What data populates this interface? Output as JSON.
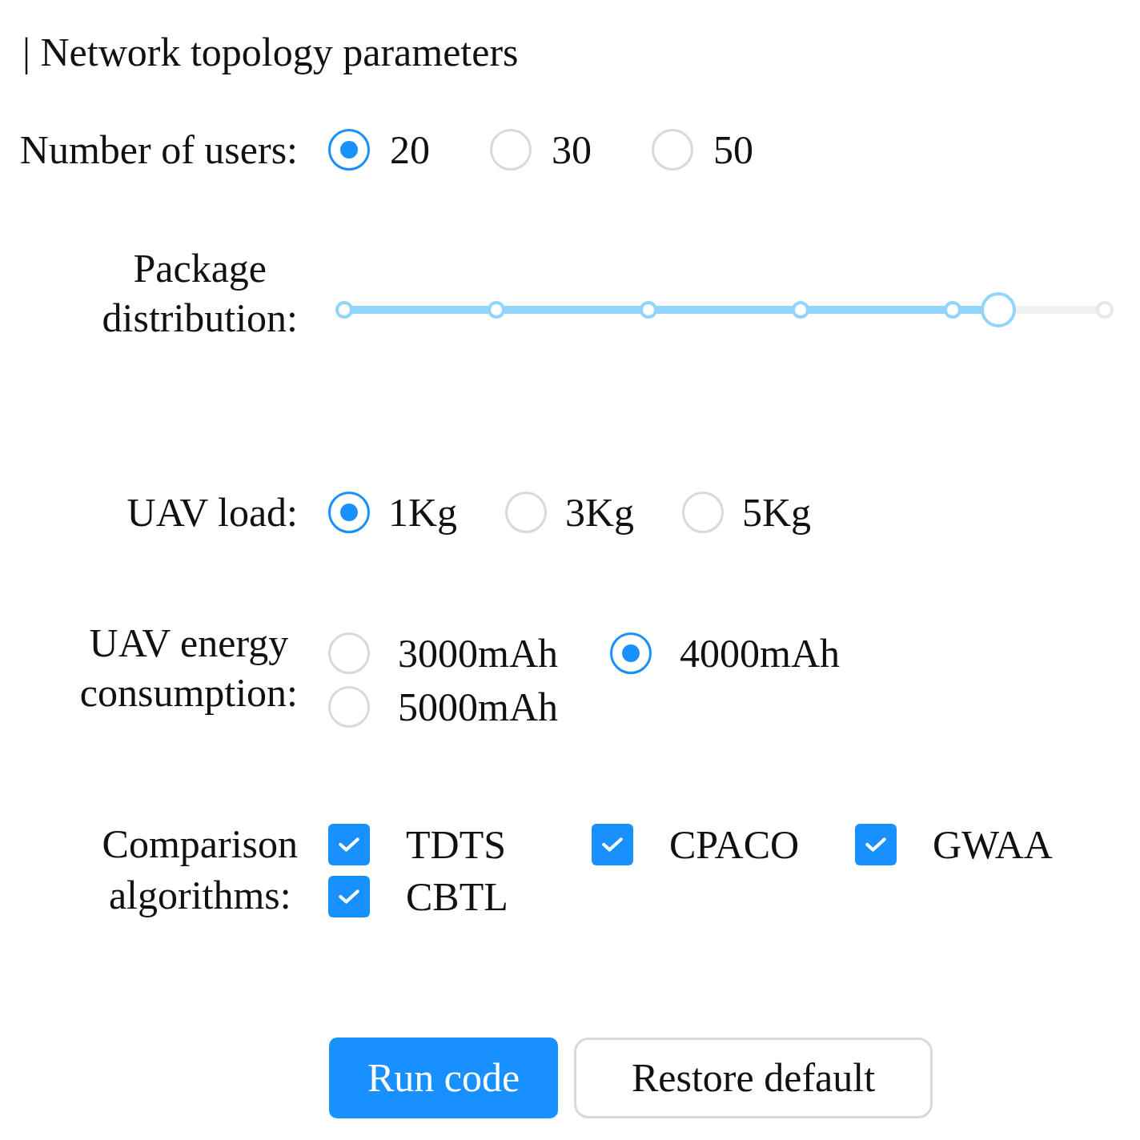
{
  "title": "| Network topology parameters",
  "rows": [
    {
      "kind": "radio",
      "label": "Number of users:",
      "options": [
        {
          "label": "20",
          "selected": true
        },
        {
          "label": "30",
          "selected": false
        },
        {
          "label": "50",
          "selected": false
        }
      ]
    },
    {
      "kind": "slider",
      "label": "Package\ndistribution:",
      "level": 0.86
    },
    {
      "kind": "radio",
      "label": "UAV load:",
      "options": [
        {
          "label": "1Kg",
          "selected": true
        },
        {
          "label": "3Kg",
          "selected": false
        },
        {
          "label": "5Kg",
          "selected": false
        }
      ]
    },
    {
      "kind": "radio",
      "label": "UAV energy\nconsumption:",
      "options": [
        {
          "label": "3000mAh",
          "selected": false
        },
        {
          "label": "4000mAh",
          "selected": true
        },
        {
          "label": "5000mAh",
          "selected": false
        }
      ]
    },
    {
      "kind": "checkbox",
      "label": "Comparison\nalgorithms:",
      "options": [
        {
          "label": "TDTS",
          "checked": true
        },
        {
          "label": "CPACO",
          "checked": true
        },
        {
          "label": "GWAA",
          "checked": true
        },
        {
          "label": "CBTL",
          "checked": true
        }
      ]
    }
  ],
  "buttons": [
    {
      "label": "Run code",
      "kind": "primary"
    },
    {
      "label": "Restore default",
      "kind": "default"
    }
  ]
}
